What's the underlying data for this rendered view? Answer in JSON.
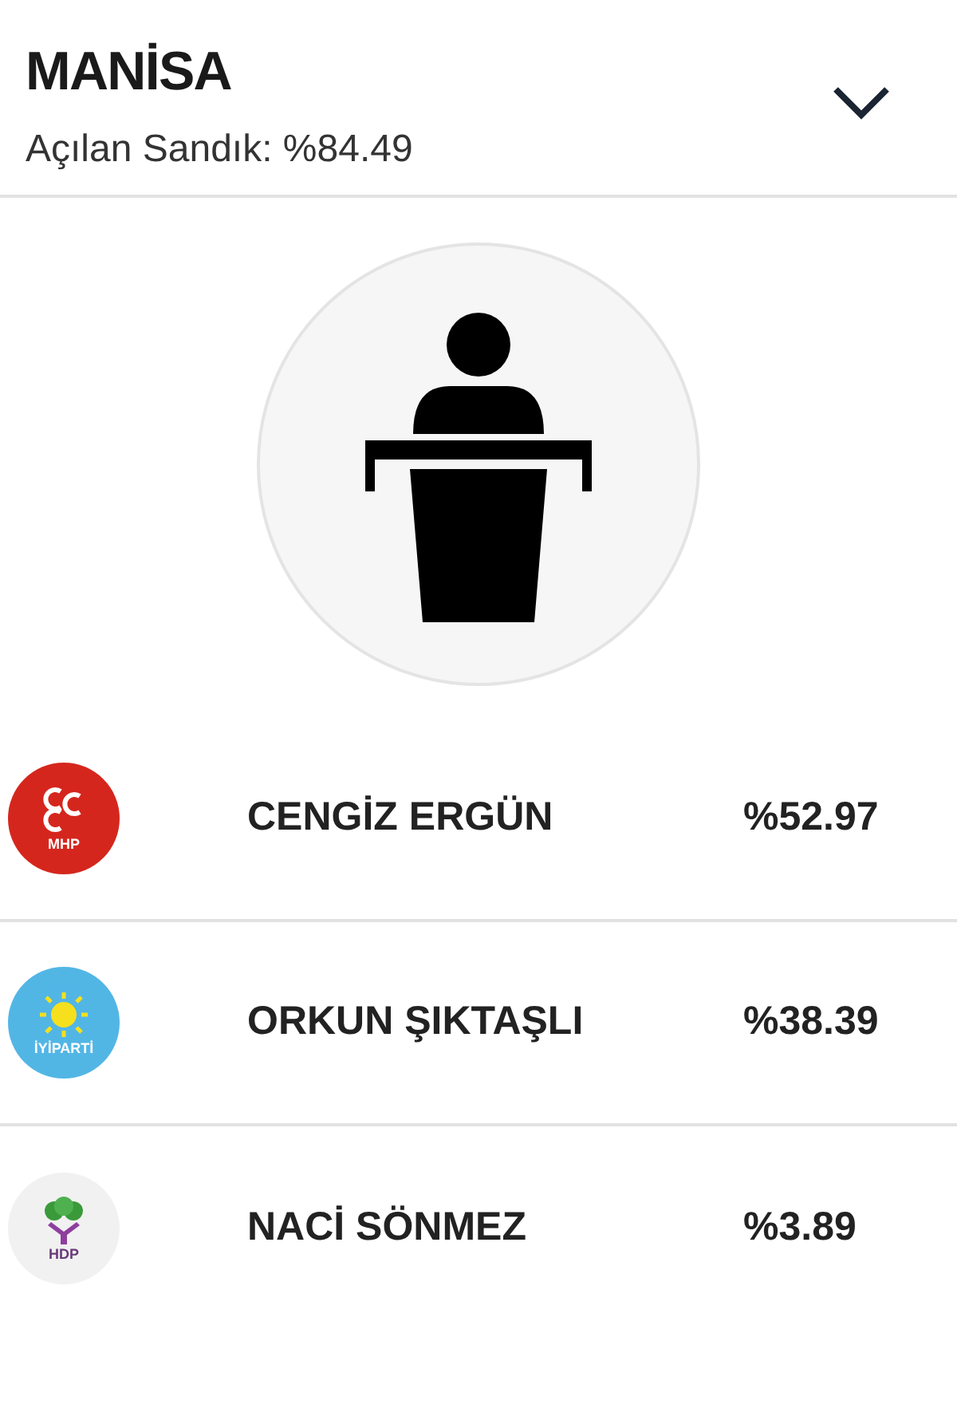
{
  "header": {
    "title": "MANİSA",
    "subtitle": "Açılan Sandık: %84.49",
    "expanded": false
  },
  "candidates": [
    {
      "kind": "crescents",
      "color": "#d5261d",
      "logo_text": "MHP",
      "name": "CENGİZ ERGÜN",
      "percent": "%52.97"
    },
    {
      "kind": "sun",
      "color": "#52b6e5",
      "logo_text": "İYİPARTİ",
      "name": "ORKUN ŞIKTAŞLI",
      "percent": "%38.39"
    },
    {
      "kind": "tree",
      "color": "#f1f1f1",
      "logo_text": "HDP",
      "name": "NACİ SÖNMEZ",
      "percent": "%3.89"
    }
  ]
}
